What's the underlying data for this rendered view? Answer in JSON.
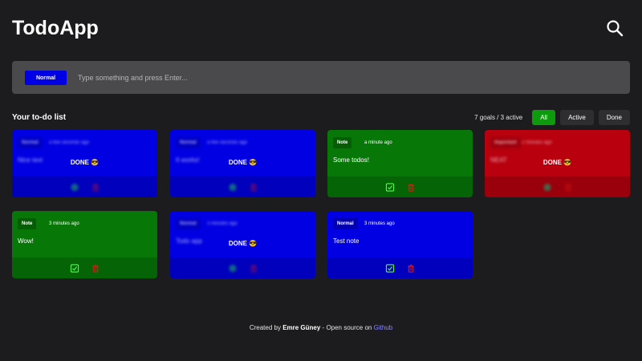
{
  "header": {
    "title": "TodoApp"
  },
  "input": {
    "priority_label": "Normal",
    "placeholder": "Type something and press Enter..."
  },
  "list": {
    "title": "Your to-do list",
    "count": "7 goals / 3 active",
    "filters": [
      "All",
      "Active",
      "Done"
    ],
    "active_filter": "All"
  },
  "cards": [
    {
      "tag": "Normal",
      "time": "a few seconds ago",
      "text": "Nice text",
      "done": true,
      "done_label": "DONE 😎",
      "color": "#0000e2"
    },
    {
      "tag": "Normal",
      "time": "a few seconds ago",
      "text": "It works!",
      "done": true,
      "done_label": "DONE 😎",
      "color": "#0000e2"
    },
    {
      "tag": "Note",
      "time": "a minute ago",
      "text": "Some todos!",
      "done": false,
      "color": "#077807"
    },
    {
      "tag": "Important",
      "time": "2 minutes ago",
      "text": "NEAT",
      "done": true,
      "done_label": "DONE 😎",
      "color": "#b8000e"
    },
    {
      "tag": "Note",
      "time": "3 minutes ago",
      "text": "Wow!",
      "done": false,
      "color": "#077807"
    },
    {
      "tag": "Normal",
      "time": "3 minutes ago",
      "text": "Todo app",
      "done": true,
      "done_label": "DONE 😎",
      "color": "#0000e2"
    },
    {
      "tag": "Normal",
      "time": "3 minutes ago",
      "text": "Test note",
      "done": false,
      "color": "#0000e2"
    }
  ],
  "footer": {
    "prefix": "Created by ",
    "author": "Emre Güney",
    "middle": " - Open source on ",
    "link": "Github"
  },
  "icons": {
    "search": "search-icon",
    "complete": "check-square-icon",
    "delete": "trash-icon"
  },
  "colors": {
    "normal": "#0000e2",
    "note": "#077807",
    "important": "#b8000e",
    "accent_filter": "#0d9a0d"
  }
}
